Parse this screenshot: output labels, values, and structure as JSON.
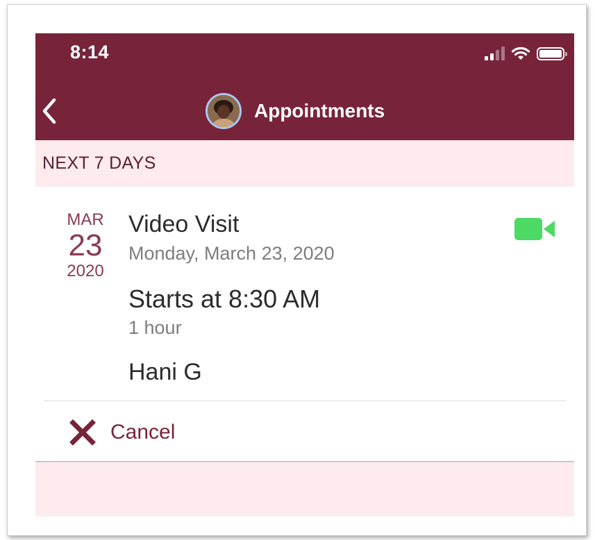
{
  "status_bar": {
    "time": "8:14",
    "icons": [
      "cellular-signal-icon",
      "wifi-icon",
      "battery-icon"
    ]
  },
  "nav": {
    "back_icon": "chevron-left-icon",
    "title": "Appointments"
  },
  "section": {
    "title": "NEXT 7 DAYS"
  },
  "appointment": {
    "month": "MAR",
    "day": "23",
    "year": "2020",
    "title": "Video Visit",
    "full_date": "Monday, March 23, 2020",
    "start": "Starts at 8:30 AM",
    "duration": "1 hour",
    "provider": "Hani G",
    "type_icon": "video-camera-icon"
  },
  "actions": {
    "cancel_label": "Cancel",
    "cancel_icon": "x-icon"
  },
  "colors": {
    "header_bg": "#77243a",
    "section_bg": "#fdebee",
    "accent": "#8a3a55",
    "video_green": "#4cd964"
  }
}
